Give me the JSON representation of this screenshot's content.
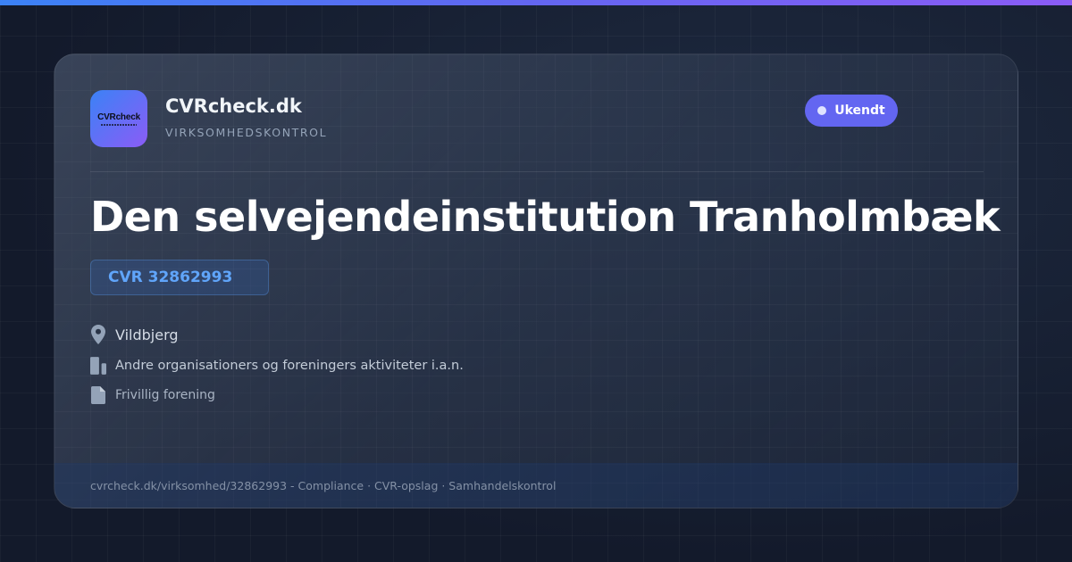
{
  "brand": {
    "logo_text": "CVRcheck",
    "name": "CVRcheck.dk",
    "tagline": "VIRKSOMHEDSKONTROL",
    "accent_colors": [
      "#3b82f6",
      "#6366f1",
      "#8b5cf6"
    ]
  },
  "status": {
    "label": "Ukendt",
    "color": "#6366f1"
  },
  "company": {
    "name": "Den selvejendeinstitution Tranholmbæk",
    "cvr": "CVR 32862993",
    "location": "Vildbjerg",
    "industry": "Andre organisationers og foreningers aktiviteter i.a.n.",
    "company_form": "Frivillig forening"
  },
  "icons": {
    "location": "map-pin-icon",
    "industry": "building-icon",
    "company_form": "document-icon"
  },
  "footer": {
    "text": "cvrcheck.dk/virksomhed/32862993 - Compliance · CVR-opslag · Samhandelskontrol"
  }
}
